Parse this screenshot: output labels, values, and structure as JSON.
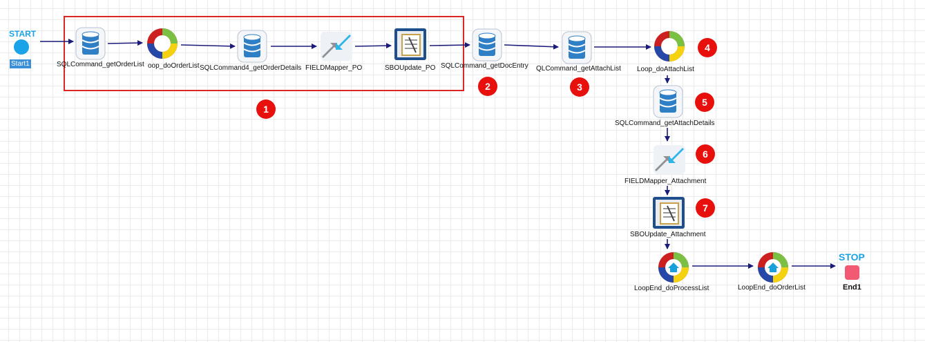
{
  "start": {
    "title": "START",
    "tag": "Start1"
  },
  "stop": {
    "title": "STOP",
    "tag": "End1"
  },
  "nodes": [
    {
      "id": "n1",
      "kind": "db",
      "label": "SQLCommand_getOrderList"
    },
    {
      "id": "n2",
      "kind": "loop",
      "label": "Loop_doOrderList"
    },
    {
      "id": "n3",
      "kind": "db",
      "label": "SQLCommand4_getOrderDetails"
    },
    {
      "id": "n4",
      "kind": "mapper",
      "label": "FIELDMapper_PO"
    },
    {
      "id": "n5",
      "kind": "sbo",
      "label": "SBOUpdate_PO"
    },
    {
      "id": "n6",
      "kind": "db",
      "label": "SQLCommand_getDocEntry"
    },
    {
      "id": "n7",
      "kind": "db",
      "label": "SQLCommand_getAttachList"
    },
    {
      "id": "n8",
      "kind": "loop",
      "label": "Loop_doAttachList"
    },
    {
      "id": "n9",
      "kind": "db",
      "label": "SQLCommand_getAttachDetails"
    },
    {
      "id": "n10",
      "kind": "mapper",
      "label": "FIELDMapper_Attachment"
    },
    {
      "id": "n11",
      "kind": "sbo",
      "label": "SBOUpdate_Attachment"
    },
    {
      "id": "n12",
      "kind": "loopend",
      "label": "LoopEnd_doProcessList"
    },
    {
      "id": "n13",
      "kind": "loopend",
      "label": "LoopEnd_doOrderList"
    }
  ],
  "displayed_labels": {
    "n1": "SQLCommand_getOrderList",
    "n2": "oop_doOrderList",
    "n3": "SQLCommand4_getOrderDetails",
    "n4": "FIELDMapper_PO",
    "n5": "SBOUpdate_PO",
    "n6": "SQLCommand_getDocEntry",
    "n7": "QLCommand_getAttachList",
    "n8": "Loop_doAttachList",
    "n9": "SQLCommand_getAttachDetails",
    "n10": "FIELDMapper_Attachment",
    "n11": "SBOUpdate_Attachment",
    "n12": "LoopEnd_doProcessList",
    "n13": "LoopEnd_doOrderList"
  },
  "badges": [
    "1",
    "2",
    "3",
    "4",
    "5",
    "6",
    "7"
  ],
  "colors": {
    "arrow": "#1a1a7a",
    "badge": "#e8100c",
    "highlight": "#dc2626",
    "start": "#1aa3e8",
    "stop": "#f15a72"
  }
}
